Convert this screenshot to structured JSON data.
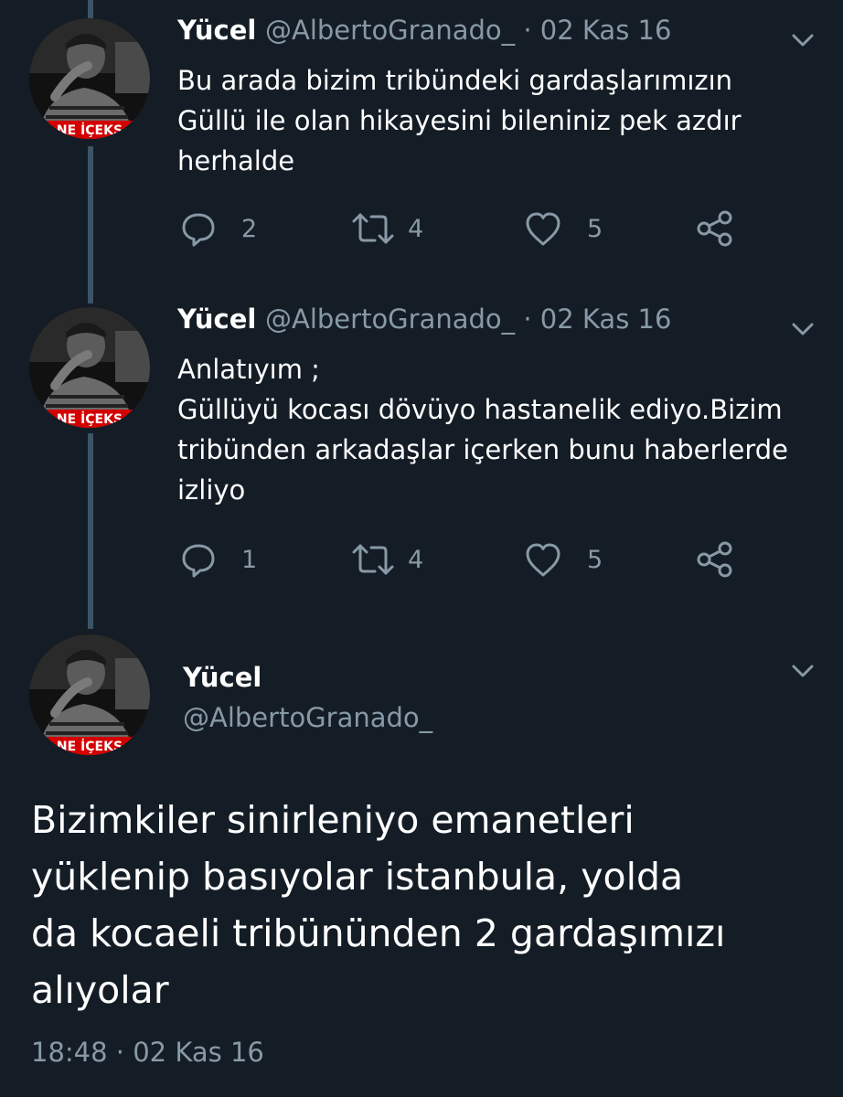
{
  "tweets": [
    {
      "name": "Yücel",
      "handle_date": "@AlbertoGranado_ · 02 Kas 16",
      "lines": [
        "Bu arada bizim tribündeki gardaşlarımızın",
        "Güllü ile olan hikayesini bileniniz pek azdır",
        "herhalde"
      ],
      "replies": "2",
      "retweets": "4",
      "likes": "5"
    },
    {
      "name": "Yücel",
      "handle_date": "@AlbertoGranado_ · 02 Kas 16",
      "lines": [
        "Anlatıyım ;",
        "Güllüyü kocası dövüyo hastanelik ediyo.Bizim",
        "tribünden arkadaşlar içerken bunu haberlerde",
        "izliyo"
      ],
      "replies": "1",
      "retweets": "4",
      "likes": "5"
    }
  ],
  "main_tweet": {
    "name": "Yücel",
    "handle": "@AlbertoGranado_",
    "lines": [
      "Bizimkiler sinirleniyo emanetleri",
      "yüklenip basıyolar istanbula, yolda",
      "da kocaeli tribününden 2 gardaşımızı",
      "alıyolar"
    ],
    "timestamp": "18:48 · 02 Kas 16"
  },
  "avatar_banner_text": "NE İÇEKS",
  "colors": {
    "background": "#141d26",
    "text": "#ffffff",
    "secondary": "#8899a6",
    "thread_line": "#3d5466",
    "avatar_banner": "#d40000"
  },
  "icons": [
    "chevron-down-icon",
    "reply-icon",
    "retweet-icon",
    "like-icon",
    "share-icon"
  ]
}
